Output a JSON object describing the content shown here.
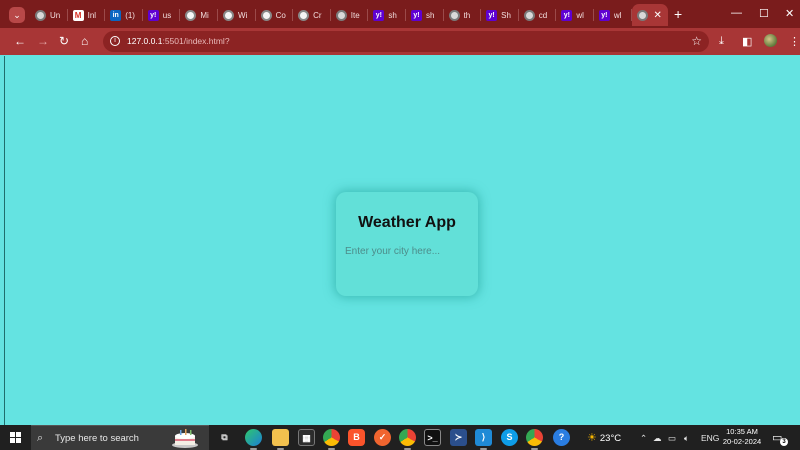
{
  "browser": {
    "tabs": [
      {
        "favicon": "globe-icon",
        "title": "Un"
      },
      {
        "favicon": "gmail-icon",
        "title": "Inl"
      },
      {
        "favicon": "linkedin-icon",
        "title": "(1)"
      },
      {
        "favicon": "yahoo-icon",
        "title": "us"
      },
      {
        "favicon": "circle-icon",
        "title": "Mi"
      },
      {
        "favicon": "circle-icon",
        "title": "Wi"
      },
      {
        "favicon": "circle-icon",
        "title": "Co"
      },
      {
        "favicon": "circle-icon",
        "title": "Cr"
      },
      {
        "favicon": "globe-icon",
        "title": "Ite"
      },
      {
        "favicon": "yahoo-icon",
        "title": "sh"
      },
      {
        "favicon": "yahoo-icon",
        "title": "sh"
      },
      {
        "favicon": "globe-icon",
        "title": "th"
      },
      {
        "favicon": "yahoo-icon",
        "title": "Sh"
      },
      {
        "favicon": "globe-icon",
        "title": "cd"
      },
      {
        "favicon": "yahoo-icon",
        "title": "wl"
      },
      {
        "favicon": "yahoo-icon",
        "title": "wl"
      }
    ],
    "active_tab": {
      "favicon": "globe-icon",
      "close": "✕"
    },
    "new_tab": "+",
    "url_host": "127.0.0.1",
    "url_path": ":5501/index.html?"
  },
  "app": {
    "title": "Weather App",
    "city_placeholder": "Enter your city here...",
    "city_value": ""
  },
  "taskbar": {
    "search_placeholder": "Type here to search",
    "temperature": "23°C",
    "language": "ENG",
    "time": "10:35 AM",
    "date": "20-02-2024",
    "notification_count": "3"
  },
  "colors": {
    "page_background": "#64e3e1",
    "browser_frame": "#a83636",
    "tab_strip": "#7a1c1c",
    "taskbar": "#202020"
  }
}
